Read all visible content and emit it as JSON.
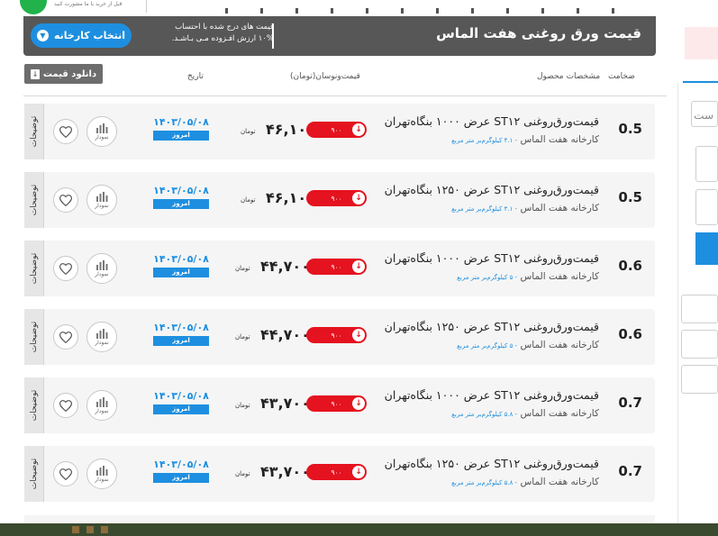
{
  "top": {
    "tagline": "قبل از خرید با ما مشورت کنید"
  },
  "header": {
    "title": "قیمت ورق روغنی هفت الماس",
    "note_line1": "قیمت های درج شده با احتساب",
    "note_line2": "۱۰% ارزش افـزوده مـی بـاشـد.",
    "factory_button": "انتخاب کارخانه"
  },
  "columns": {
    "thickness": "ضخامت",
    "specs": "مشخصات محصول",
    "price_change": "قیمت‌ونوسان(تومان)",
    "date": "تاریخ"
  },
  "download_button": "دانلود قیمت",
  "row_labels": {
    "description_tab": "توضیحات",
    "chart_label": "نمودار",
    "currency": "تومان",
    "today": "امروز"
  },
  "rows": [
    {
      "thickness": "0.5",
      "name": "قیمت‌ورق‌روغنی ST۱۲ عرض ۱۰۰۰ بنگاه‌تهران",
      "factory": "کارخانه هفت الماس",
      "weight": "- ۴.۱ کیلوگرم‌بر متر مربع",
      "price": "۴۶,۱۰۰",
      "change": "۹۰۰",
      "date": "۱۴۰۳/۰۵/۰۸"
    },
    {
      "thickness": "0.5",
      "name": "قیمت‌ورق‌روغنی ST۱۲ عرض ۱۲۵۰ بنگاه‌تهران",
      "factory": "کارخانه هفت الماس",
      "weight": "- ۴.۱ کیلوگرم‌بر متر مربع",
      "price": "۴۶,۱۰۰",
      "change": "۹۰۰",
      "date": "۱۴۰۳/۰۵/۰۸"
    },
    {
      "thickness": "0.6",
      "name": "قیمت‌ورق‌روغنی ST۱۲ عرض ۱۰۰۰ بنگاه‌تهران",
      "factory": "کارخانه هفت الماس",
      "weight": "- ۵ کیلوگرم‌بر متر مربع",
      "price": "۴۴,۷۰۰",
      "change": "۹۰۰",
      "date": "۱۴۰۳/۰۵/۰۸"
    },
    {
      "thickness": "0.6",
      "name": "قیمت‌ورق‌روغنی ST۱۲ عرض ۱۲۵۰ بنگاه‌تهران",
      "factory": "کارخانه هفت الماس",
      "weight": "- ۵ کیلوگرم‌بر متر مربع",
      "price": "۴۴,۷۰۰",
      "change": "۹۰۰",
      "date": "۱۴۰۳/۰۵/۰۸"
    },
    {
      "thickness": "0.7",
      "name": "قیمت‌ورق‌روغنی ST۱۲ عرض ۱۰۰۰ بنگاه‌تهران",
      "factory": "کارخانه هفت الماس",
      "weight": "- ۵.۸ کیلوگرم‌بر متر مربع",
      "price": "۴۳,۷۰۰",
      "change": "۹۰۰",
      "date": "۱۴۰۳/۰۵/۰۸"
    },
    {
      "thickness": "0.7",
      "name": "قیمت‌ورق‌روغنی ST۱۲ عرض ۱۲۵۰ بنگاه‌تهران",
      "factory": "کارخانه هفت الماس",
      "weight": "- ۵.۸ کیلوگرم‌بر متر مربع",
      "price": "۴۳,۷۰۰",
      "change": "۹۰۰",
      "date": "۱۴۰۳/۰۵/۰۸"
    }
  ],
  "right_panel": {
    "box_text": "ست"
  },
  "colors": {
    "header_bg": "#575757",
    "accent_blue": "#1e8fe0",
    "down_red": "#e5121f",
    "row_bg": "#f5f5f5"
  },
  "icons": [
    "heart-icon",
    "bar-chart-icon",
    "arrow-down-circle-icon",
    "chevron-down-icon",
    "download-icon"
  ]
}
